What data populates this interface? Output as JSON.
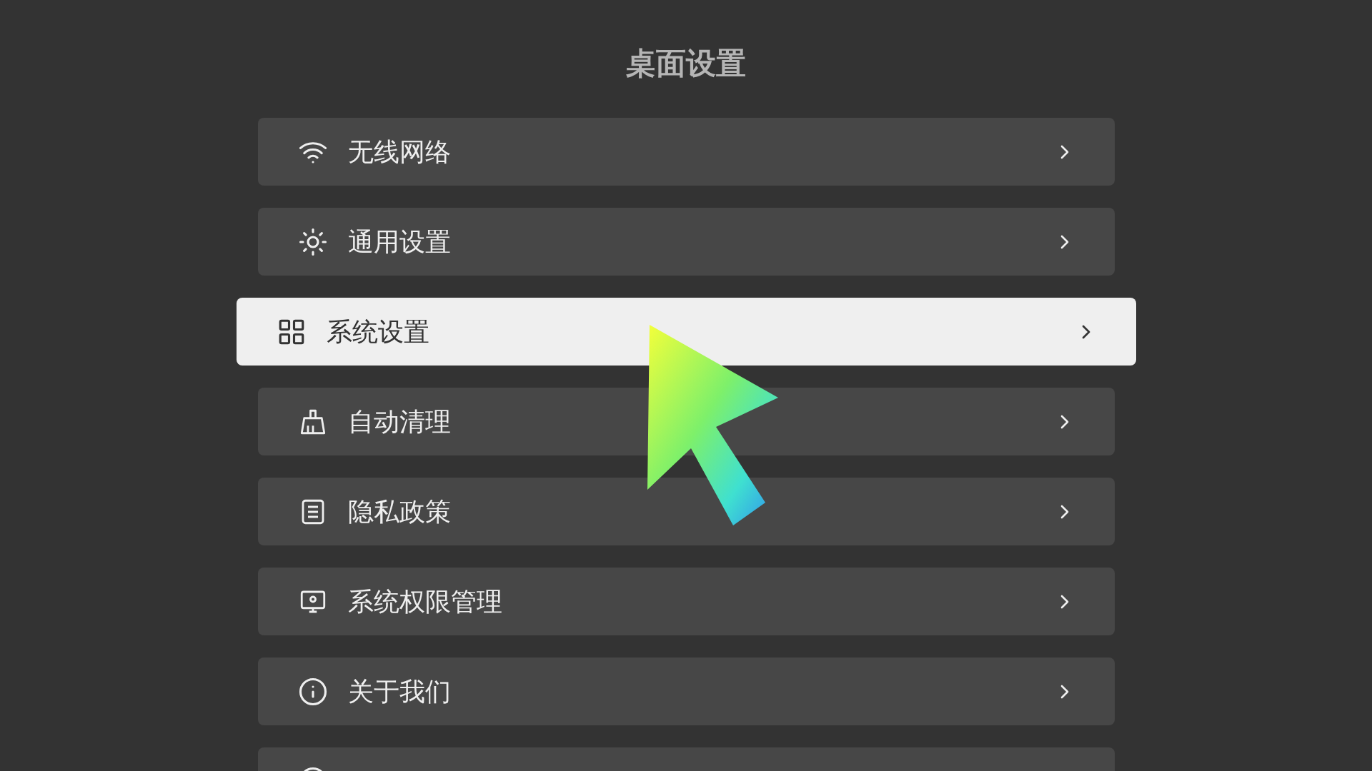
{
  "title": "桌面设置",
  "items": [
    {
      "label": "无线网络",
      "selected": false
    },
    {
      "label": "通用设置",
      "selected": false
    },
    {
      "label": "系统设置",
      "selected": true
    },
    {
      "label": "自动清理",
      "selected": false
    },
    {
      "label": "隐私政策",
      "selected": false
    },
    {
      "label": "系统权限管理",
      "selected": false
    },
    {
      "label": "关于我们",
      "selected": false
    }
  ]
}
